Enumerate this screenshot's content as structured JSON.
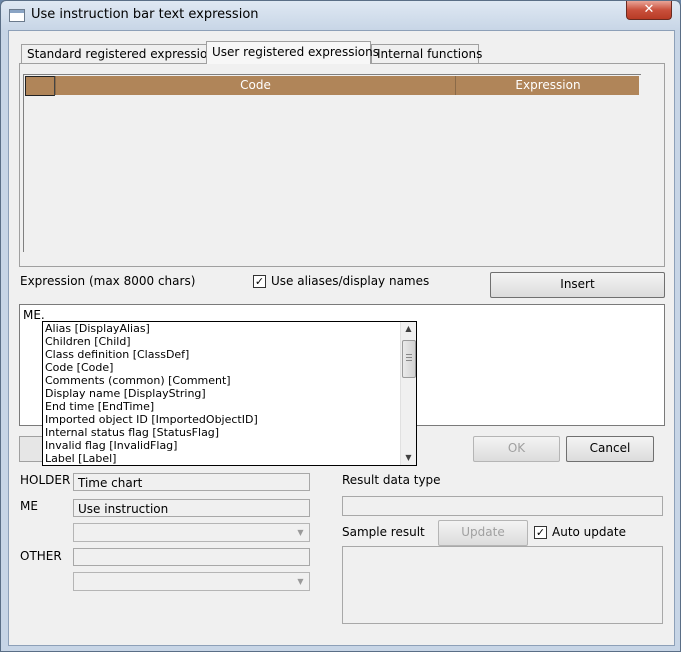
{
  "window": {
    "title": "Use instruction bar text expression",
    "close_label": "✕"
  },
  "tabs": [
    {
      "label": "Standard registered expressions",
      "active": false
    },
    {
      "label": "User registered expressions",
      "active": true
    },
    {
      "label": "Internal functions",
      "active": false
    }
  ],
  "grid": {
    "columns": [
      "Code",
      "Expression"
    ],
    "rows": []
  },
  "expression": {
    "label": "Expression (max 8000 chars)",
    "value": "ME.",
    "use_aliases_label": "Use aliases/display names",
    "use_aliases_checked": true,
    "insert_label": "Insert"
  },
  "autocomplete": {
    "items": [
      "Alias [DisplayAlias]",
      "Children [Child]",
      "Class definition [ClassDef]",
      "Code [Code]",
      "Comments (common) [Comment]",
      "Display name [DisplayString]",
      "End time [EndTime]",
      "Imported object ID [ImportedObjectID]",
      "Internal status flag [StatusFlag]",
      "Invalid flag [InvalidFlag]",
      "Label [Label]"
    ]
  },
  "buttons": {
    "ok": "OK",
    "cancel": "Cancel",
    "update": "Update"
  },
  "context": {
    "holder_label": "HOLDER",
    "holder_value": "Time chart",
    "me_label": "ME",
    "me_value": "Use instruction",
    "me_select_value": "",
    "other_label": "OTHER",
    "other_value": "",
    "other_select_value": ""
  },
  "result": {
    "data_type_label": "Result data type",
    "data_type_value": "",
    "sample_label": "Sample result",
    "auto_update_label": "Auto update",
    "auto_update_checked": true,
    "sample_value": ""
  },
  "colors": {
    "grid_header": "#b08559",
    "close_button": "#c9503c",
    "title_bar": "#c7d5e6"
  }
}
